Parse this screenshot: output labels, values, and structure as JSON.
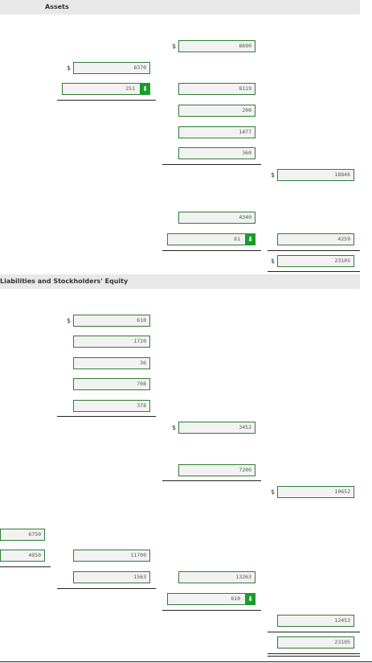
{
  "sections": {
    "assets_title": "Assets",
    "liabilities_title": "Liabilities and Stockholders' Equity"
  },
  "currency_symbol": "$",
  "indicator_glyph": "⬇",
  "assets": {
    "col3_first": "8690",
    "col2_first": "8370",
    "col2_second": "251",
    "col3_a": "8119",
    "col3_b": "200",
    "col3_c": "1477",
    "col3_d": "360",
    "col4_subtotal": "18846",
    "col3_e": "4340",
    "col3_f": "81",
    "col4_second": "4259",
    "col4_total": "23105"
  },
  "liabilities": {
    "col2_a": "610",
    "col2_b": "1720",
    "col2_c": "36",
    "col2_d": "708",
    "col2_e": "378",
    "col3_subtotal": "3452",
    "col3_second": "7200",
    "col4_subtotal": "10652",
    "col1_a": "6750",
    "col1_b": "4950",
    "col2_f": "11700",
    "col2_g": "1563",
    "col3_h": "13263",
    "col3_i": "810",
    "col4_equity": "12453",
    "col4_total": "23105"
  }
}
